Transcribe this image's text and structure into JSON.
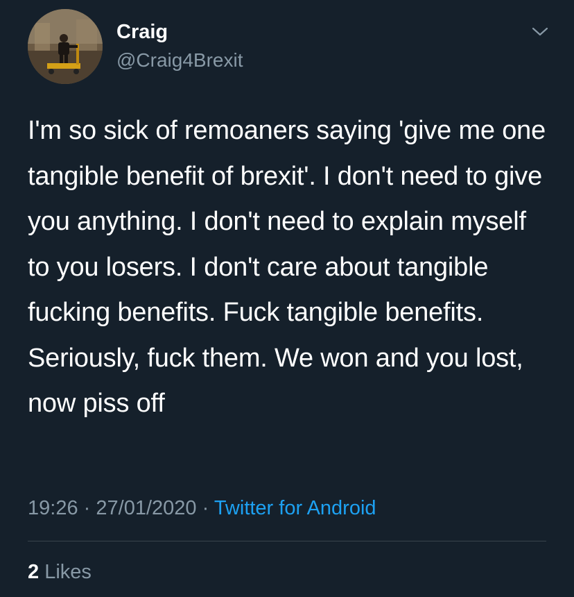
{
  "user": {
    "display_name": "Craig",
    "handle": "@Craig4Brexit",
    "avatar_icon": "profile-photo"
  },
  "menu_icon": "chevron-down-icon",
  "tweet": {
    "text": "I'm so sick of remoaners saying 'give me one tangible benefit of brexit'. I don't need to give you anything. I don't need to explain myself to you losers. I don't care about tangible fucking benefits. Fuck tangible benefits. Seriously, fuck them. We won and you lost, now piss off",
    "time": "19:26",
    "separator": "·",
    "date": "27/01/2020",
    "source": "Twitter for Android"
  },
  "stats": {
    "likes_count": "2",
    "likes_label": "Likes"
  },
  "colors": {
    "background": "#15202b",
    "text": "#ffffff",
    "secondary_text": "#8899a6",
    "link": "#1da1f2",
    "divider": "#38444d"
  }
}
